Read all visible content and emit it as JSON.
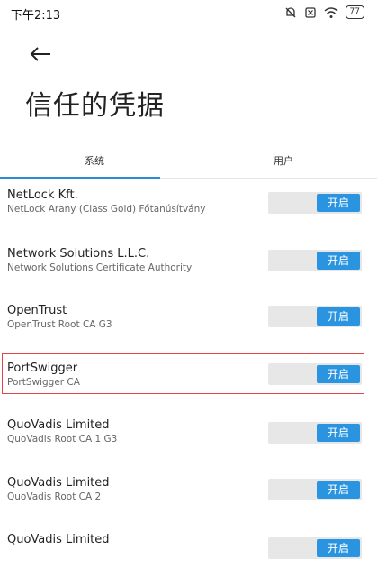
{
  "status": {
    "time": "下午2:13",
    "battery": "77"
  },
  "page": {
    "title": "信任的凭据"
  },
  "tabs": [
    {
      "label": "系统"
    },
    {
      "label": "用户"
    }
  ],
  "toggle_label": "开启",
  "credentials": [
    {
      "name": "NetLock Kft.",
      "detail": "NetLock Arany (Class Gold) Főtanúsítvány",
      "enabled": true
    },
    {
      "name": "Network Solutions L.L.C.",
      "detail": "Network Solutions Certificate Authority",
      "enabled": true
    },
    {
      "name": "OpenTrust",
      "detail": "OpenTrust Root CA G3",
      "enabled": true
    },
    {
      "name": "PortSwigger",
      "detail": "PortSwigger CA",
      "enabled": true
    },
    {
      "name": "QuoVadis Limited",
      "detail": "QuoVadis Root CA 1 G3",
      "enabled": true
    },
    {
      "name": "QuoVadis Limited",
      "detail": "QuoVadis Root CA 2",
      "enabled": true
    },
    {
      "name": "QuoVadis Limited",
      "detail": "",
      "enabled": true
    }
  ],
  "colors": {
    "accent": "#2a94e0",
    "highlight": "#e64545"
  }
}
